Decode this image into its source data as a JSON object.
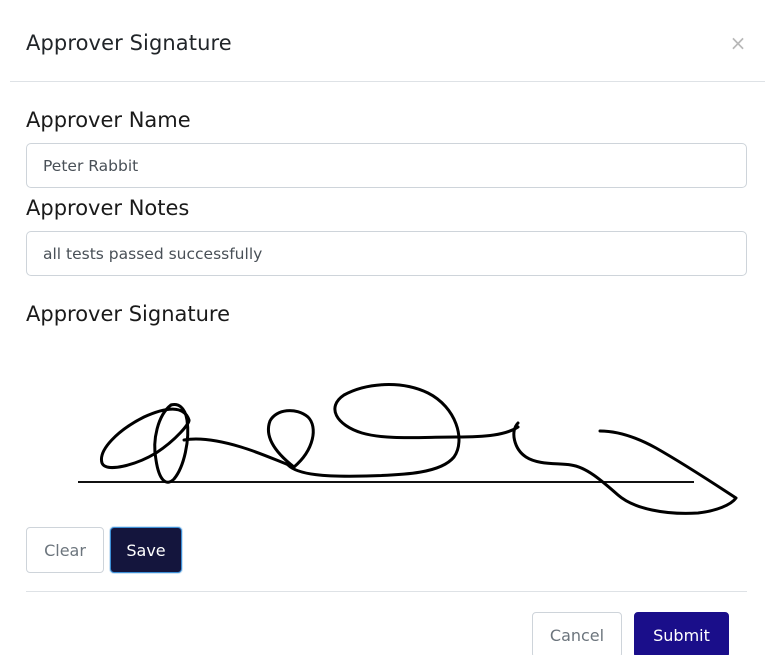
{
  "modal": {
    "title": "Approver Signature",
    "close_symbol": "×",
    "close_icon": "close-icon"
  },
  "form": {
    "name_label": "Approver Name",
    "name_value": "Peter Rabbit",
    "notes_label": "Approver Notes",
    "notes_value": "all tests passed successfully",
    "signature_label": "Approver Signature"
  },
  "signature_pad": {
    "stroke_color": "#000000",
    "baseline_color": "#111111"
  },
  "buttons": {
    "clear_label": "Clear",
    "save_label": "Save",
    "cancel_label": "Cancel",
    "submit_label": "Submit"
  },
  "colors": {
    "save_bg": "#14153d",
    "submit_bg": "#1a0e8a"
  }
}
